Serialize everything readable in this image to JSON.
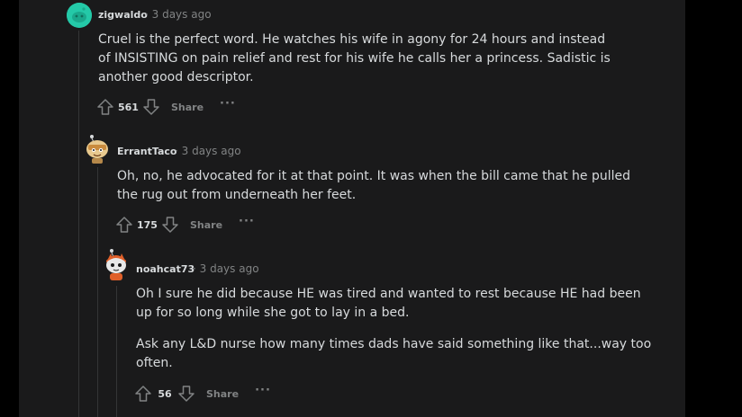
{
  "comments": [
    {
      "username": "zigwaldo",
      "meta": "· 3 days ago",
      "paragraphs": [
        "Cruel is the perfect word. He watches his wife in agony for 24 hours and instead of INSISTING on pain relief and rest for his wife he calls her a princess. Sadistic is another good descriptor."
      ],
      "score": "561",
      "share_label": "Share",
      "more_label": "···"
    },
    {
      "username": "ErrantTaco",
      "meta": "· 3 days ago",
      "paragraphs": [
        "Oh, no, he advocated for it at that point. It was when the bill came that he pulled the rug out from underneath her feet."
      ],
      "score": "175",
      "share_label": "Share",
      "more_label": "···"
    },
    {
      "username": "noahcat73",
      "meta": "· 3 days ago",
      "paragraphs": [
        "Oh I sure he did because HE was tired and wanted to rest because HE had been up for so long while she got to lay in a bed.",
        "Ask any L&D nurse how many times dads have said something like that...way too often."
      ],
      "score": "56",
      "share_label": "Share",
      "more_label": "···"
    }
  ],
  "colors": {
    "page_bg": "#000000",
    "panel_bg": "#1a1a1b",
    "text": "#d7dadc",
    "muted": "#818384",
    "thread_line": "#343536",
    "avatar_teal": "#24c9a8"
  },
  "icons": {
    "upvote": "arrow-up-outline",
    "downvote": "arrow-down-outline",
    "more": "horizontal-ellipsis",
    "avatar_1": "teal-snoo-avatar",
    "avatar_2": "taco-snoo-avatar",
    "avatar_3": "cat-hat-snoo-avatar"
  }
}
